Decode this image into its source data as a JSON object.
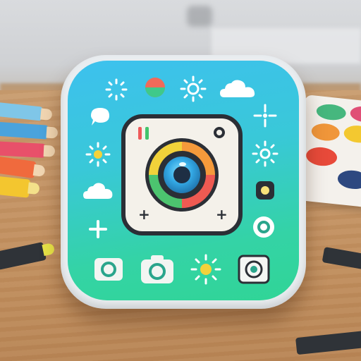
{
  "scene": {
    "subject": "app-icon",
    "icon_names": [
      "sun-sparkle-icon",
      "color-dot-icon",
      "sun-icon",
      "cloud-icon",
      "chat-bubble-icon",
      "sparkle-icon",
      "camera-lens-icon",
      "plus-icon",
      "camera-icon",
      "focus-circle-icon",
      "target-square-icon"
    ]
  },
  "colors": {
    "icon_gradient_top": "#3dc1ee",
    "icon_gradient_bottom": "#30d596",
    "lens_ring": [
      "#f59a3b",
      "#ef5a52",
      "#4cc46f",
      "#f1d23a"
    ],
    "lens_core": "#33a8e4",
    "outline": "#2b2f36",
    "wood": "#c2905f"
  }
}
